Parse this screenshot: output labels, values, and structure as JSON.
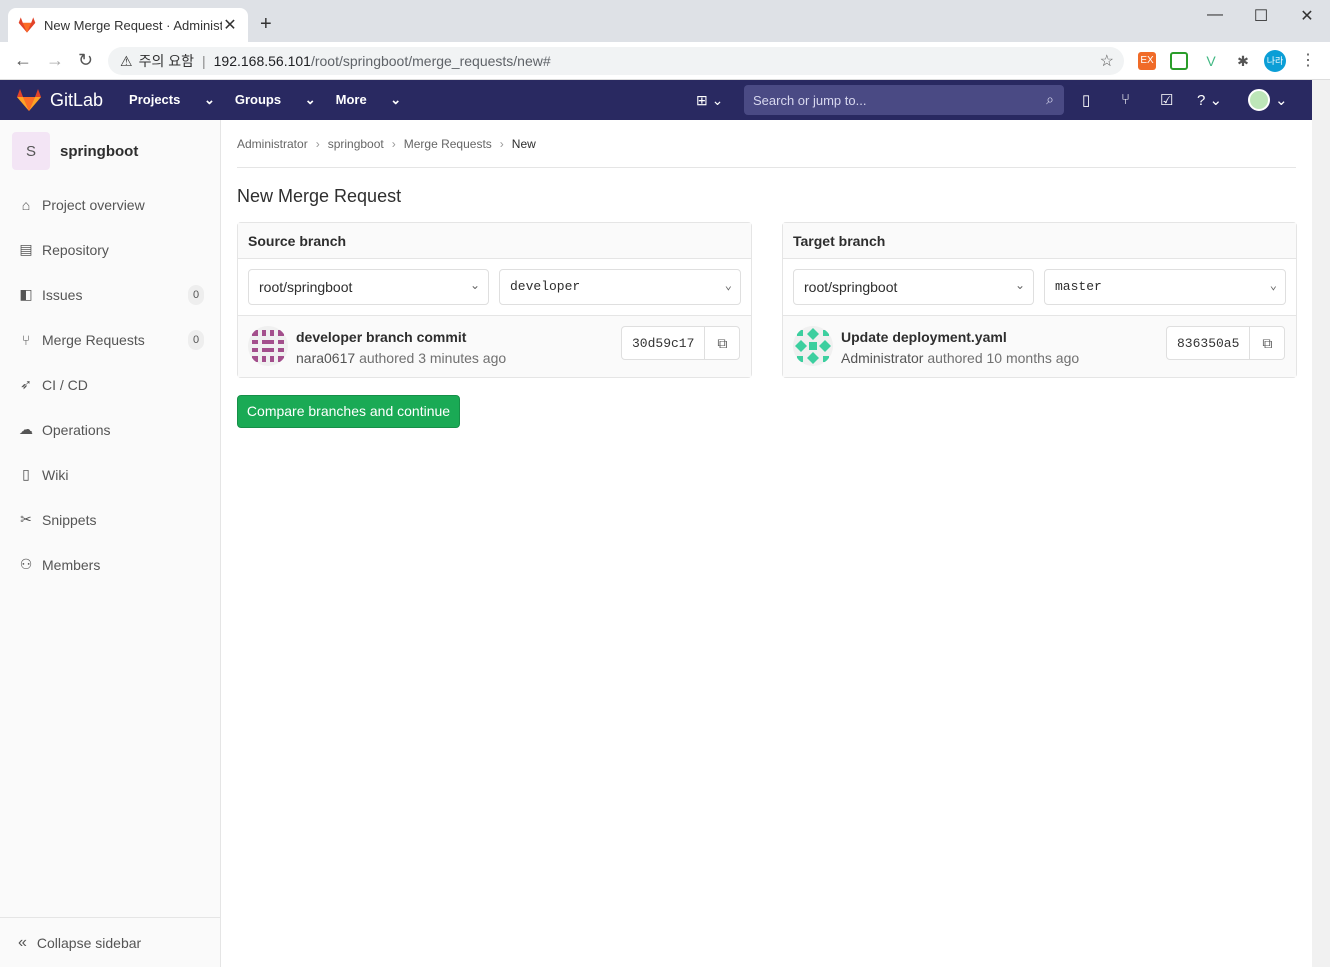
{
  "browser": {
    "tab_title": "New Merge Request · Administrator",
    "new_tab": "+",
    "address_warning": "주의 요함",
    "address_sep": "|",
    "address_host": "192.168.56.101",
    "address_path": "/root/springboot/merge_requests/new#",
    "profile_label": "나라"
  },
  "header": {
    "brand": "GitLab",
    "menu": [
      "Projects",
      "Groups",
      "More"
    ],
    "search_placeholder": "Search or jump to..."
  },
  "sidebar": {
    "project_initial": "S",
    "project_name": "springboot",
    "items": [
      {
        "label": "Project overview",
        "icon": "home-icon"
      },
      {
        "label": "Repository",
        "icon": "doc-icon"
      },
      {
        "label": "Issues",
        "icon": "issues-icon",
        "count": "0"
      },
      {
        "label": "Merge Requests",
        "icon": "merge-request-icon",
        "count": "0"
      },
      {
        "label": "CI / CD",
        "icon": "rocket-icon"
      },
      {
        "label": "Operations",
        "icon": "cloud-gear-icon"
      },
      {
        "label": "Wiki",
        "icon": "book-icon"
      },
      {
        "label": "Snippets",
        "icon": "scissors-icon"
      },
      {
        "label": "Members",
        "icon": "users-icon"
      }
    ],
    "collapse_label": "Collapse sidebar"
  },
  "breadcrumb": [
    "Administrator",
    "springboot",
    "Merge Requests",
    "New"
  ],
  "page_title": "New Merge Request",
  "source": {
    "title": "Source branch",
    "project": "root/springboot",
    "branch": "developer",
    "commit_message": "developer branch commit",
    "commit_author": "nara0617",
    "commit_time": "authored 3 minutes ago",
    "sha": "30d59c17"
  },
  "target": {
    "title": "Target branch",
    "project": "root/springboot",
    "branch": "master",
    "commit_message": "Update deployment.yaml",
    "commit_author": "Administrator",
    "commit_time": "authored 10 months ago",
    "sha": "836350a5"
  },
  "compare_button": "Compare branches and continue"
}
